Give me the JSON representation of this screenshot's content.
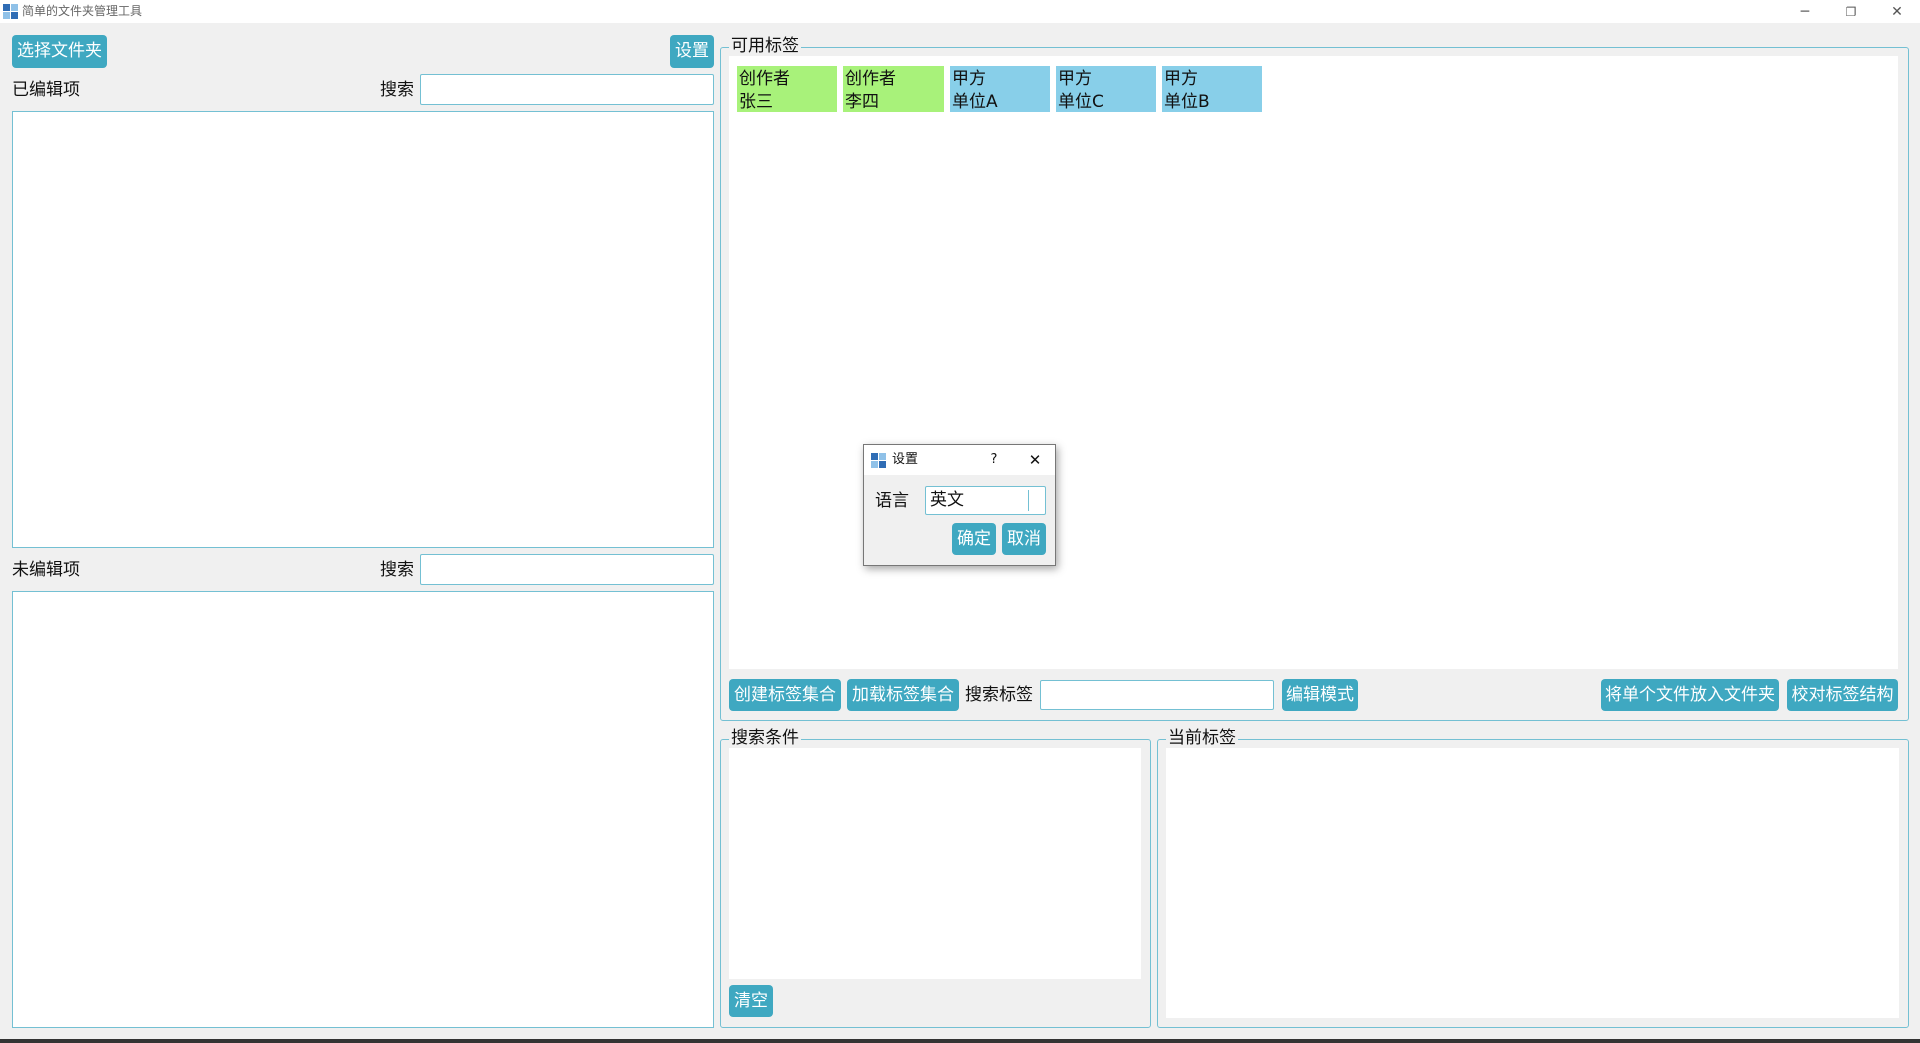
{
  "window": {
    "title": "简单的文件夹管理工具",
    "minimize_glyph": "─",
    "restore_glyph": "❐",
    "close_glyph": "✕"
  },
  "left": {
    "select_folder_button": "选择文件夹",
    "settings_button": "设置",
    "edited": {
      "label": "已编辑项",
      "search_label": "搜索",
      "search_value": ""
    },
    "unedited": {
      "label": "未编辑项",
      "search_label": "搜索",
      "search_value": ""
    }
  },
  "tags": {
    "group_title": "可用标签",
    "items": [
      {
        "line1": "创作者",
        "line2": "张三",
        "color": "#a8f27a"
      },
      {
        "line1": "创作者",
        "line2": "李四",
        "color": "#a8f27a"
      },
      {
        "line1": "甲方",
        "line2": "单位A",
        "color": "#88cfe9"
      },
      {
        "line1": "甲方",
        "line2": "单位C",
        "color": "#88cfe9"
      },
      {
        "line1": "甲方",
        "line2": "单位B",
        "color": "#88cfe9"
      }
    ],
    "toolbar": {
      "create_set": "创建标签集合",
      "load_set": "加载标签集合",
      "search_label": "搜索标签",
      "search_value": "",
      "edit_mode": "编辑模式",
      "put_single_file": "将单个文件放入文件夹",
      "verify_structure": "校对标签结构"
    }
  },
  "search_conditions": {
    "title": "搜索条件",
    "clear_button": "清空"
  },
  "current_tags": {
    "title": "当前标签"
  },
  "settings_dialog": {
    "title": "设置",
    "help_glyph": "?",
    "close_glyph": "✕",
    "language_label": "语言",
    "language_value": "英文",
    "ok_button": "确定",
    "cancel_button": "取消"
  },
  "colors": {
    "accent": "#3fa8c1",
    "border": "#74c0d3",
    "tag_green": "#a8f27a",
    "tag_blue": "#88cfe9"
  }
}
